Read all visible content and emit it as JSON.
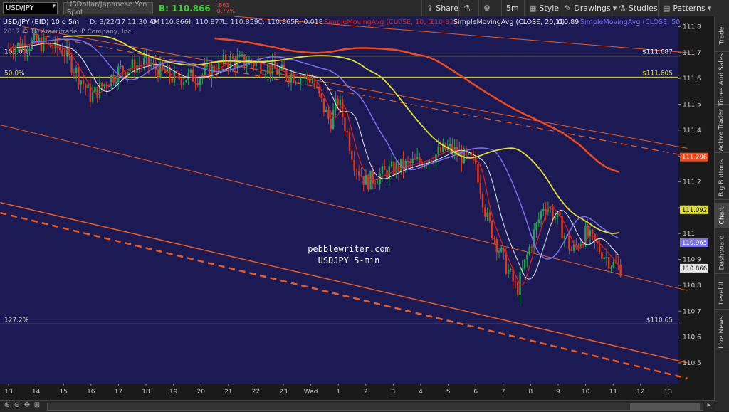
{
  "toolbar": {
    "symbol": "USD/JPY",
    "description": "USDollar/Japanese Yen Spot",
    "last": "B: 110.866",
    "change_abs": "-.863",
    "change_pct": "-0.77%",
    "share": "Share",
    "timeframe": "5m",
    "style": "Style",
    "drawings": "Drawings",
    "studies": "Studies",
    "patterns": "Patterns"
  },
  "sidebar_tabs": [
    "Trade",
    "Times And Sales",
    "Active Trader",
    "Big Buttons",
    "Chart",
    "Dashboard",
    "Level II",
    "Live News"
  ],
  "chart_header": {
    "symbol_info": "USD/JPY (BID) 10 d 5m",
    "d": "D: 3/22/17 11:30 AM",
    "o": "O: 110.866",
    "h": "H: 110.877",
    "l": "L: 110.859",
    "c": "C: 110.865",
    "r": "R: 0.018",
    "sma10": "SimpleMovingAvg (CLOSE, 10, 0)",
    "sma10_val": "110.831",
    "sma20": "SimpleMovingAvg (CLOSE, 20, 0)",
    "sma20_val": "110.89",
    "sma50": "SimpleMovingAvg (CLOSE, 50,...",
    "copyright": "2017 © TD Ameritrade IP Company, Inc."
  },
  "watermark": {
    "line1": "pebblewriter.com",
    "line2": "USDJPY 5-min"
  },
  "colors": {
    "bg": "#1b1a55",
    "up": "#22a84a",
    "down": "#e03a1a",
    "sma10": "#d42020",
    "sma20": "#e8e8e8",
    "sma50": "#7b70f0",
    "sma100": "#e0e030",
    "sma200": "#f04a1a",
    "channel": "#f05a1a",
    "fib100": "#ffffff",
    "fib50": "#e0e030",
    "fib127": "#cfcfcf"
  },
  "chart_data": {
    "type": "candlestick",
    "ylim": [
      110.42,
      111.84
    ],
    "y_ticks": [
      "111.8",
      "111.7",
      "111.6",
      "111.5",
      "111.4",
      "111.3",
      "111.2",
      "111.1",
      "111",
      "110.9",
      "110.8",
      "110.7",
      "110.6",
      "110.5"
    ],
    "x_ticks": [
      "13",
      "14",
      "15",
      "16",
      "17",
      "18",
      "19",
      "20",
      "21",
      "22",
      "23",
      "Wed",
      "1",
      "2",
      "3",
      "4",
      "5",
      "6",
      "7",
      "8",
      "9",
      "10",
      "11",
      "12",
      "13"
    ],
    "fib_levels": [
      {
        "label": "100.0%",
        "value": 111.687,
        "display": "$111.687"
      },
      {
        "label": "50.0%",
        "value": 111.605,
        "display": "$111.605"
      },
      {
        "label": "127.2%",
        "value": 110.65,
        "display": "$110.65"
      }
    ],
    "price_flags": [
      {
        "value": 111.296,
        "text": "111.296",
        "color": "#f04a1a"
      },
      {
        "value": 111.092,
        "text": "111.092",
        "color": "#e0e030"
      },
      {
        "value": 110.965,
        "text": "110.965",
        "color": "#7b70f0"
      },
      {
        "value": 110.866,
        "text": "110.866",
        "color": "#e8e8e8"
      }
    ],
    "close_path": [
      [
        0,
        111.72
      ],
      [
        1,
        111.74
      ],
      [
        2,
        111.71
      ],
      [
        3,
        111.53
      ],
      [
        4,
        111.63
      ],
      [
        5,
        111.66
      ],
      [
        6,
        111.6
      ],
      [
        7,
        111.61
      ],
      [
        8,
        111.67
      ],
      [
        9,
        111.66
      ],
      [
        10,
        111.62
      ],
      [
        11,
        111.6
      ],
      [
        11.7,
        111.43
      ],
      [
        12,
        111.52
      ],
      [
        12.6,
        111.27
      ],
      [
        13,
        111.2
      ],
      [
        14,
        111.25
      ],
      [
        15,
        111.28
      ],
      [
        16,
        111.33
      ],
      [
        17,
        111.27
      ],
      [
        17.4,
        111.06
      ],
      [
        18,
        110.9
      ],
      [
        18.5,
        110.78
      ],
      [
        19,
        110.96
      ],
      [
        19.5,
        111.12
      ],
      [
        20,
        111.05
      ],
      [
        20.5,
        110.93
      ],
      [
        21,
        111.0
      ],
      [
        21.5,
        110.94
      ],
      [
        22,
        110.88
      ],
      [
        22.3,
        110.866
      ]
    ]
  }
}
